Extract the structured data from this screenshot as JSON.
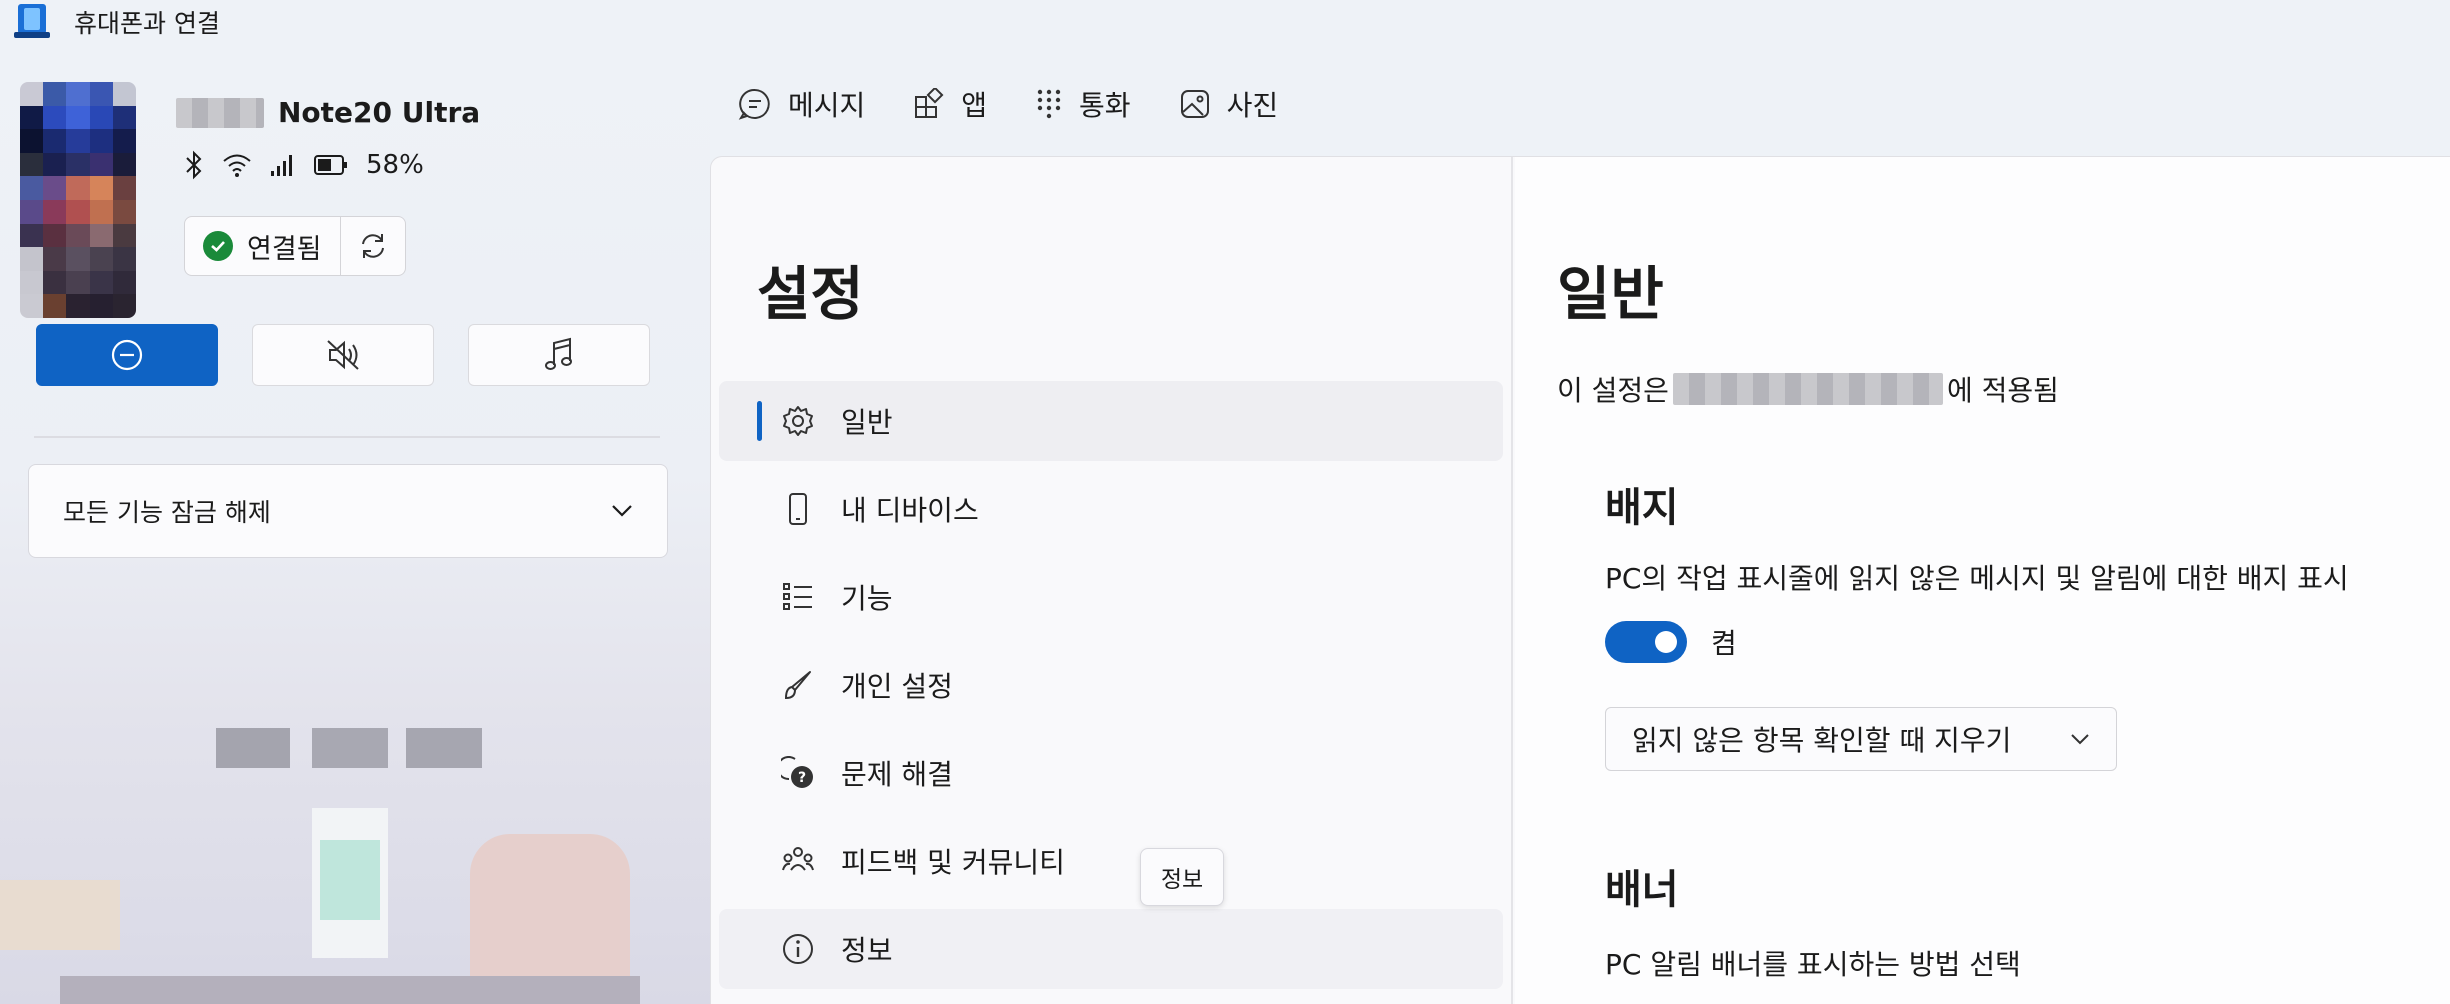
{
  "window": {
    "title": "휴대폰과 연결"
  },
  "device": {
    "name": "Note20 Ultra",
    "battery": "58%",
    "connection_status": "연결됨"
  },
  "quick_actions": [
    {
      "icon": "do-not-disturb-icon",
      "active": true
    },
    {
      "icon": "mute-icon",
      "active": false
    },
    {
      "icon": "music-note-icon",
      "active": false
    }
  ],
  "unlock": {
    "label": "모든 기능 잠금 해제"
  },
  "nav": {
    "tabs": [
      {
        "label": "메시지",
        "icon": "message-icon"
      },
      {
        "label": "앱",
        "icon": "apps-icon"
      },
      {
        "label": "통화",
        "icon": "dialpad-icon"
      },
      {
        "label": "사진",
        "icon": "photos-icon"
      }
    ]
  },
  "settings": {
    "title": "설정",
    "menu": [
      {
        "label": "일반",
        "icon": "gear-icon",
        "selected": true
      },
      {
        "label": "내 디바이스",
        "icon": "phone-icon"
      },
      {
        "label": "기능",
        "icon": "list-icon"
      },
      {
        "label": "개인 설정",
        "icon": "brush-icon"
      },
      {
        "label": "문제 해결",
        "icon": "help-chat-icon"
      },
      {
        "label": "피드백 및 커뮤니티",
        "icon": "community-icon"
      },
      {
        "label": "정보",
        "icon": "info-icon"
      }
    ],
    "tooltip": "정보"
  },
  "detail": {
    "title": "일반",
    "desc_prefix": "이 설정은 ",
    "desc_suffix": "에 적용됨",
    "badge": {
      "title": "배지",
      "desc": "PC의 작업 표시줄에 읽지 않은 메시지 및 알림에 대한 배지 표시",
      "toggle_label": "켬",
      "toggle_on": true,
      "dropdown_value": "읽지 않은 항목 확인할 때 지우기"
    },
    "banner": {
      "title": "배너",
      "desc": "PC 알림 배너를 표시하는 방법 선택"
    }
  },
  "colors": {
    "accent": "#0f63c4",
    "success": "#1a8a3a"
  }
}
